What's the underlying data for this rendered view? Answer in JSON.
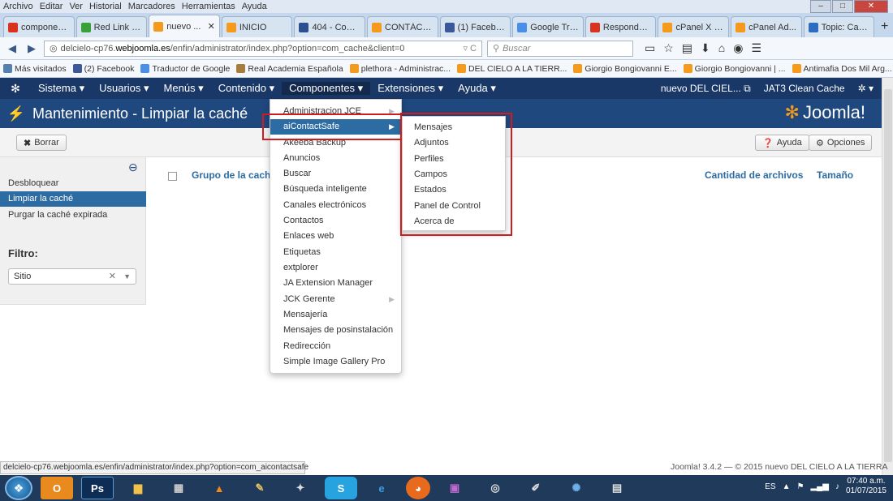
{
  "browser_menu": [
    "Archivo",
    "Editar",
    "Ver",
    "Historial",
    "Marcadores",
    "Herramientas",
    "Ayuda"
  ],
  "tabs": [
    {
      "label": "componen...",
      "color": "#d9331f"
    },
    {
      "label": "Red Link - ...",
      "color": "#3aa03a"
    },
    {
      "label": "nuevo ...",
      "color": "#f59a1b",
      "active": true
    },
    {
      "label": "INICIO",
      "color": "#f59a1b"
    },
    {
      "label": "404 - Com...",
      "color": "#2c4f8f"
    },
    {
      "label": "CONTÁCT...",
      "color": "#f59a1b"
    },
    {
      "label": "(1) Facebook",
      "color": "#3b5998"
    },
    {
      "label": "Google Tra...",
      "color": "#4a8ee8"
    },
    {
      "label": "Responder ...",
      "color": "#d9331f"
    },
    {
      "label": "cPanel X - ...",
      "color": "#f59a1b"
    },
    {
      "label": "cPanel Ad...",
      "color": "#f59a1b"
    },
    {
      "label": "Topic: Can...",
      "color": "#2c6dbf"
    }
  ],
  "url": {
    "prefix": "delcielo-cp76.",
    "domain": "webjoomla.es",
    "path": "/enfin/administrator/index.php?option=com_cache&client=0"
  },
  "search_placeholder": "Buscar",
  "bookmarks": [
    "Más visitados",
    "(2) Facebook",
    "Traductor de Google",
    "Real Academia Española",
    "plethora - Administrac...",
    "DEL CIELO A LA TIERR...",
    "Giorgio Bongiovanni E...",
    "Giorgio Bongiovanni | ...",
    "Antimafia Dos Mil Arg..."
  ],
  "joomla_menu": [
    "Sistema ▾",
    "Usuarios ▾",
    "Menús ▾",
    "Contenido ▾",
    "Componentes ▾",
    "Extensiones ▾",
    "Ayuda ▾"
  ],
  "site_link": "nuevo DEL CIEL...",
  "clean_cache": "JAT3 Clean Cache",
  "page_title": "Mantenimiento - Limpiar la caché",
  "joomla_logo": "Joomla!",
  "toolbar": {
    "delete": "Borrar",
    "help": "Ayuda",
    "options": "Opciones"
  },
  "sidebar": {
    "items": [
      "Desbloquear",
      "Limpiar la caché",
      "Purgar la caché expirada"
    ],
    "filter_label": "Filtro:",
    "filter_value": "Sitio"
  },
  "table_headers": {
    "group": "Grupo de la caché",
    "count": "Cantidad de archivos",
    "size": "Tamaño"
  },
  "components_menu": [
    "Administracion JCE",
    "aiContactSafe",
    "Akeeba Backup",
    "Anuncios",
    "Buscar",
    "Búsqueda inteligente",
    "Canales electrónicos",
    "Contactos",
    "Enlaces web",
    "Etiquetas",
    "extplorer",
    "JA Extension Manager",
    "JCK Gerente",
    "Mensajería",
    "Mensajes de posinstalación",
    "Redirección",
    "Simple Image Gallery Pro"
  ],
  "submenu": [
    "Mensajes",
    "Adjuntos",
    "Perfiles",
    "Campos",
    "Estados",
    "Panel de Control",
    "Acerca de"
  ],
  "status_url": "delcielo-cp76.webjoomla.es/enfin/administrator/index.php?option=com_aicontactsafe",
  "footer": "Joomla! 3.4.2 — © 2015 nuevo DEL CIELO A LA TIERRA",
  "tray": {
    "lang": "ES",
    "time": "07:40 a.m.",
    "date": "01/07/2015"
  },
  "colors": {
    "joomla_top": "#1a3867",
    "joomla_header": "#1f487f",
    "accent": "#2d6ca2",
    "highlight": "#d01c1c"
  }
}
